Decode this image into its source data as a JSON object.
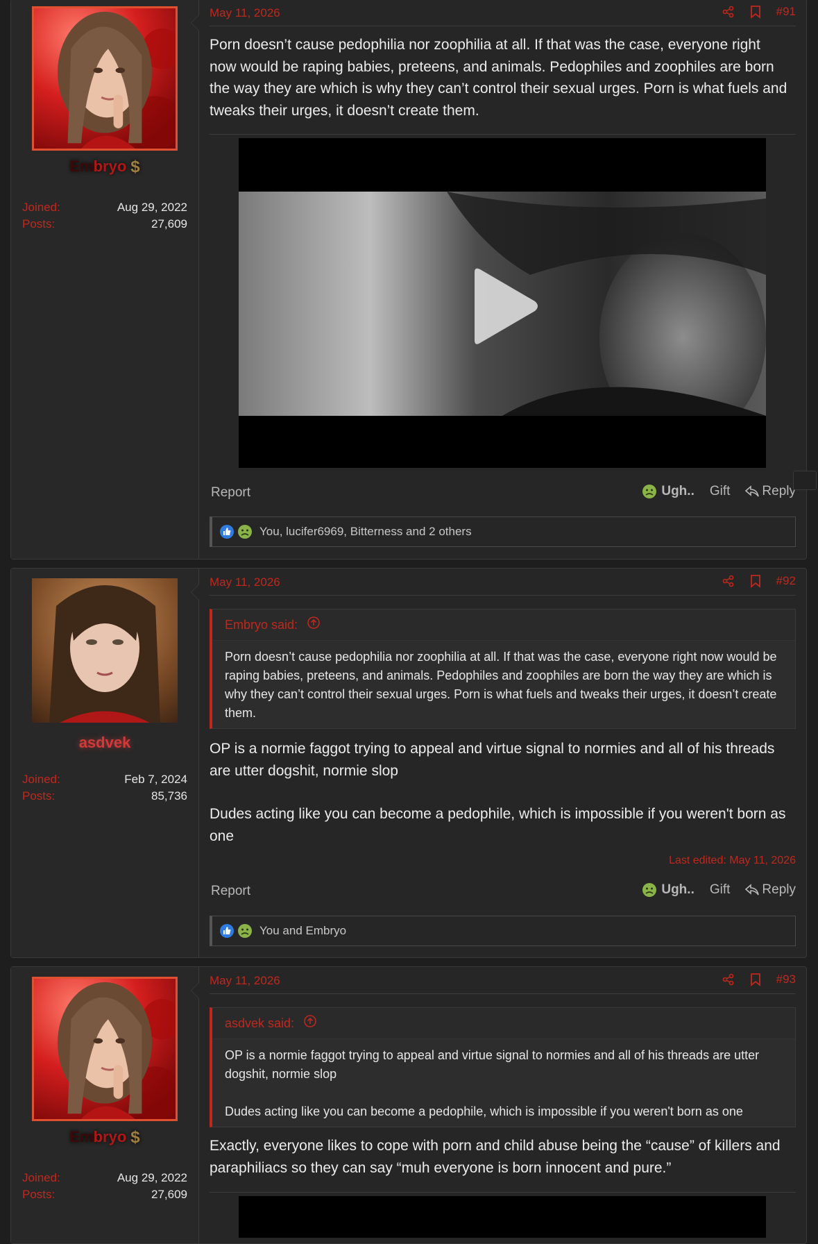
{
  "posts": [
    {
      "user": {
        "name_a": "Em",
        "name_b": "bryo",
        "joined_label": "Joined:",
        "joined": "Aug 29, 2022",
        "posts_label": "Posts:",
        "posts": "27,609"
      },
      "date": "May 11, 2026",
      "number": "#91",
      "body": [
        "Porn doesn’t cause pedophilia nor zoophilia at all. If that was the case, everyone right now would be raping babies, preteens, and animals. Pedophiles and zoophiles are born the way they are which is why they can’t control their sexual urges. Porn is what fuels and tweaks their urges, it doesn’t create them."
      ],
      "actions": {
        "report": "Report",
        "ugh": "Ugh..",
        "gift": "Gift",
        "reply": "Reply"
      },
      "reactions": "You, lucifer6969, Bitterness and 2 others"
    },
    {
      "user": {
        "name": "asdvek",
        "joined_label": "Joined:",
        "joined": "Feb 7, 2024",
        "posts_label": "Posts:",
        "posts": "85,736"
      },
      "date": "May 11, 2026",
      "number": "#92",
      "quote": {
        "author": "Embryo said:",
        "paragraphs": [
          "Porn doesn’t cause pedophilia nor zoophilia at all. If that was the case, everyone right now would be raping babies, preteens, and animals. Pedophiles and zoophiles are born the way they are which is why they can’t control their sexual urges. Porn is what fuels and tweaks their urges, it doesn’t create them."
        ]
      },
      "body": [
        "OP is a normie faggot trying to appeal and virtue signal to normies and all of his threads are utter dogshit, normie slop",
        "Dudes acting like you can become a pedophile, which is impossible if you weren't born as one"
      ],
      "edited": "Last edited: May 11, 2026",
      "actions": {
        "report": "Report",
        "ugh": "Ugh..",
        "gift": "Gift",
        "reply": "Reply"
      },
      "reactions": "You and Embryo"
    },
    {
      "user": {
        "name_a": "Em",
        "name_b": "bryo",
        "joined_label": "Joined:",
        "joined": "Aug 29, 2022",
        "posts_label": "Posts:",
        "posts": "27,609"
      },
      "date": "May 11, 2026",
      "number": "#93",
      "quote": {
        "author": "asdvek said:",
        "paragraphs": [
          "OP is a normie faggot trying to appeal and virtue signal to normies and all of his threads are utter dogshit, normie slop",
          "Dudes acting like you can become a pedophile, which is impossible if you weren't born as one"
        ]
      },
      "body": [
        "Exactly, everyone likes to cope with porn and child abuse being the “cause” of killers and paraphiliacs so they can say “muh everyone is born innocent and pure.”"
      ]
    }
  ],
  "colors": {
    "accent": "#c0281e",
    "background": "#1e1e1e",
    "panel": "#262626"
  },
  "icons": [
    "share-icon",
    "bookmark-icon",
    "play-icon",
    "ugh-emoji-icon",
    "reply-icon",
    "like-icon",
    "quote-up-arrow-icon",
    "dollar-icon"
  ]
}
